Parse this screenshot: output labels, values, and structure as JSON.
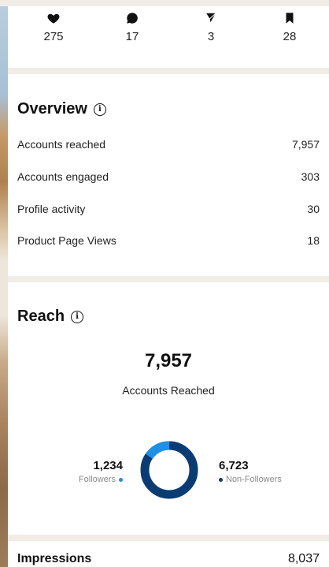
{
  "stats": [
    {
      "icon": "heart-icon",
      "value": "275"
    },
    {
      "icon": "comment-icon",
      "value": "17"
    },
    {
      "icon": "share-icon",
      "value": "3"
    },
    {
      "icon": "bookmark-icon",
      "value": "28"
    }
  ],
  "overview": {
    "title": "Overview",
    "rows": [
      {
        "label": "Accounts reached",
        "value": "7,957"
      },
      {
        "label": "Accounts engaged",
        "value": "303"
      },
      {
        "label": "Profile activity",
        "value": "30"
      },
      {
        "label": "Product Page Views",
        "value": "18"
      }
    ]
  },
  "reach": {
    "title": "Reach",
    "total": "7,957",
    "total_label": "Accounts Reached",
    "followers": {
      "value": "1,234",
      "label": "Followers",
      "color": "#1e90e6"
    },
    "non_followers": {
      "value": "6,723",
      "label": "Non-Followers",
      "color": "#0b3b73"
    }
  },
  "impressions": {
    "label": "Impressions",
    "value": "8,037"
  },
  "colors": {
    "followers": "#1e90e6",
    "non_followers": "#0b3b73"
  }
}
